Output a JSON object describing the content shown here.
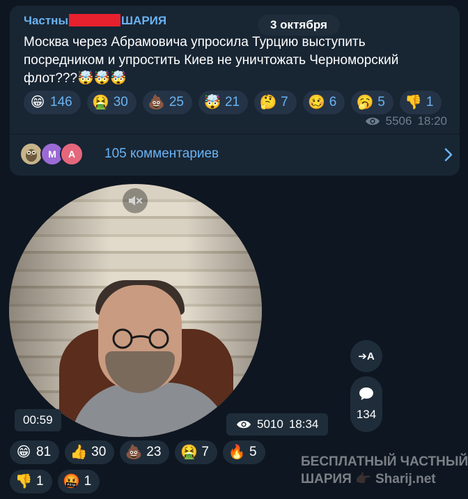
{
  "post": {
    "channel_prefix": "Частны",
    "channel_suffix": "ШАРИЯ",
    "date": "3 октября",
    "text": "Москва через Абрамовича упросила Турцию выступить посредником и упростить Киев не уничтожать Черноморский флот???🤯🤯🤯",
    "reactions": [
      {
        "emoji": "😁",
        "count": "146",
        "icon": "grinning-face-icon"
      },
      {
        "emoji": "🤮",
        "count": "30",
        "icon": "vomiting-face-icon"
      },
      {
        "emoji": "💩",
        "count": "25",
        "icon": "poop-icon"
      },
      {
        "emoji": "🤯",
        "count": "21",
        "icon": "exploding-head-icon"
      },
      {
        "emoji": "🤔",
        "count": "7",
        "icon": "thinking-face-icon"
      },
      {
        "emoji": "🥴",
        "count": "6",
        "icon": "woozy-face-icon"
      },
      {
        "emoji": "🥱",
        "count": "5",
        "icon": "yawning-face-icon"
      },
      {
        "emoji": "👎",
        "count": "1",
        "icon": "thumbs-down-icon"
      }
    ],
    "views": "5506",
    "time": "18:20",
    "comments": {
      "avatars": [
        "",
        "M",
        "A"
      ],
      "label": "105 комментариев"
    }
  },
  "video": {
    "duration": "00:59",
    "views": "5010",
    "time": "18:34",
    "translate_label": "➔A",
    "comments_count": "134",
    "reactions": [
      {
        "emoji": "😁",
        "count": "81",
        "icon": "grinning-face-icon"
      },
      {
        "emoji": "👍",
        "count": "30",
        "icon": "thumbs-up-icon"
      },
      {
        "emoji": "💩",
        "count": "23",
        "icon": "poop-icon"
      },
      {
        "emoji": "🤮",
        "count": "7",
        "icon": "vomiting-face-icon"
      },
      {
        "emoji": "🔥",
        "count": "5",
        "icon": "fire-icon"
      },
      {
        "emoji": "👎",
        "count": "1",
        "icon": "thumbs-down-icon"
      },
      {
        "emoji": "🤬",
        "count": "1",
        "icon": "cursing-face-icon"
      }
    ]
  },
  "watermark": {
    "line1": "БЕСПЛАТНЫЙ ЧАСТНЫЙ",
    "line2": "ШАРИЯ 👉🏿 Sharij.net"
  },
  "colors": {
    "background": "#0e1621",
    "card": "#182533",
    "accent": "#6ab3f3",
    "muted": "#6d7f8f"
  }
}
